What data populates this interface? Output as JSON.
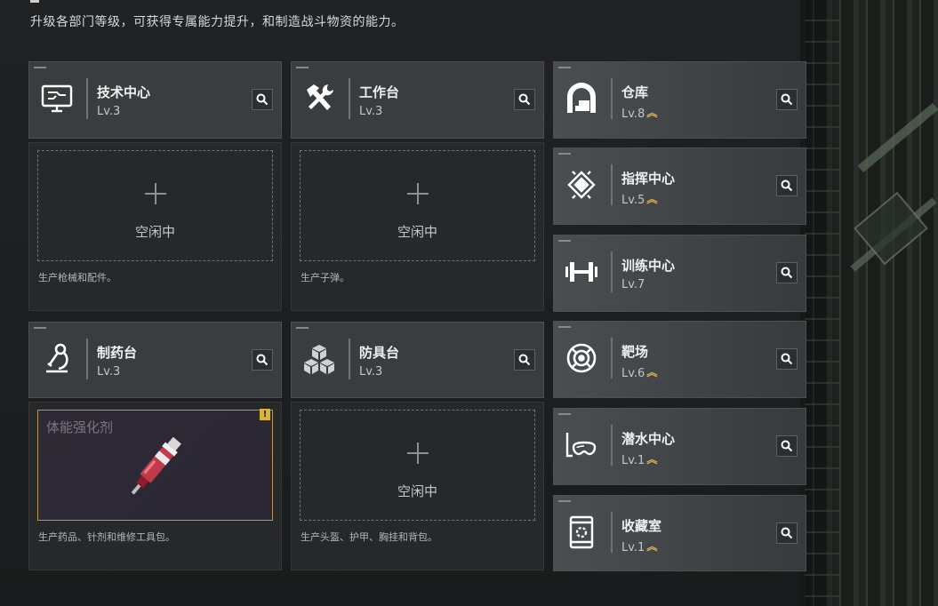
{
  "header": {
    "description": "升级各部门等级，可获得专属能力提升，和制造战斗物资的能力。"
  },
  "left_cards": [
    {
      "name": "技术中心",
      "level": "Lv.3",
      "icon": "monitor-icon"
    },
    {
      "name": "工作台",
      "level": "Lv.3",
      "icon": "tools-icon"
    },
    {
      "name": "制药台",
      "level": "Lv.3",
      "icon": "microscope-icon"
    },
    {
      "name": "防具台",
      "level": "Lv.3",
      "icon": "cubes-icon"
    }
  ],
  "production": [
    {
      "slot_status": "空闲中",
      "desc": "生产枪械和配件。"
    },
    {
      "slot_status": "空闲中",
      "desc": "生产子弹。"
    },
    {
      "item_name": "体能强化剂",
      "alert": "!",
      "desc": "生产药品、针剂和维修工具包。"
    },
    {
      "slot_status": "空闲中",
      "desc": "生产头盔、护甲、胸挂和背包。"
    }
  ],
  "right_cards": [
    {
      "name": "仓库",
      "level": "Lv.8",
      "upgrade": "︽",
      "icon": "warehouse-icon"
    },
    {
      "name": "指挥中心",
      "level": "Lv.5",
      "upgrade": "︽",
      "icon": "chip-icon"
    },
    {
      "name": "训练中心",
      "level": "Lv.7",
      "icon": "dumbbell-icon"
    },
    {
      "name": "靶场",
      "level": "Lv.6",
      "upgrade": "︽",
      "icon": "target-icon"
    },
    {
      "name": "潜水中心",
      "level": "Lv.1",
      "upgrade": "︽",
      "icon": "diving-mask-icon"
    },
    {
      "name": "收藏室",
      "level": "Lv.1",
      "upgrade": "︽",
      "icon": "display-case-icon"
    }
  ],
  "colors": {
    "upgrade": "#e2b347",
    "accent_border": "#b89652"
  }
}
